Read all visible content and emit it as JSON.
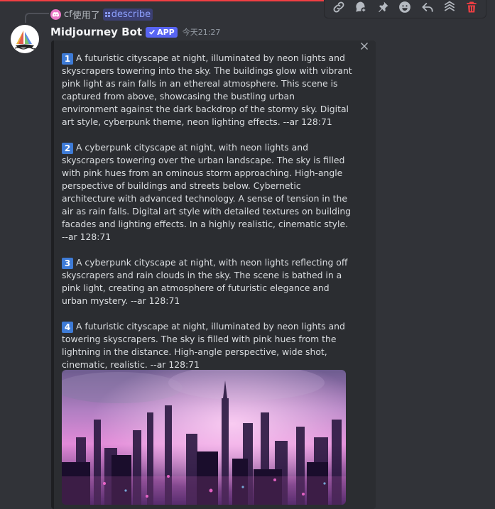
{
  "reply": {
    "user": "cf",
    "action": "使用了",
    "command": "describe"
  },
  "message": {
    "username": "Midjourney Bot",
    "badge": "APP",
    "timestamp": "今天21:27"
  },
  "embed": {
    "prompts": [
      {
        "num": "1",
        "text": "A futuristic cityscape at night, illuminated by neon lights and skyscrapers towering into the sky. The buildings glow with vibrant pink light as rain falls in an ethereal atmosphere. This scene is captured from above, showcasing the bustling urban environment against the dark backdrop of the stormy sky. Digital art style, cyberpunk theme, neon lighting effects. --ar 128:71"
      },
      {
        "num": "2",
        "text": "A cyberpunk cityscape at night, with neon lights and skyscrapers towering over the urban landscape. The sky is filled with pink hues from an ominous storm approaching. High-angle perspective of buildings and streets below. Cybernetic architecture with advanced technology. A sense of tension in the air as rain falls. Digital art style with detailed textures on building facades and lighting effects. In a highly realistic, cinematic style. --ar 128:71"
      },
      {
        "num": "3",
        "text": "A cyberpunk cityscape at night, with neon lights reflecting off skyscrapers and rain clouds in the sky. The scene is bathed in a pink light, creating an atmosphere of futuristic elegance and urban mystery. --ar 128:71"
      },
      {
        "num": "4",
        "text": "A futuristic cityscape at night, illuminated by neon lights and towering skyscrapers. The sky is filled with pink hues from the lightning in the distance. High-angle perspective, wide shot, cinematic, realistic. --ar 128:71"
      }
    ]
  },
  "toolbar_icons": [
    "link-icon",
    "thread-icon",
    "pin-icon",
    "emoji-icon",
    "reply-icon",
    "apps-icon",
    "delete-icon"
  ],
  "colors": {
    "background": "#313338",
    "embed_bg": "#2b2d31",
    "blurple": "#5865f2",
    "number_badge": "#3e7bd6",
    "danger": "#f23f43"
  }
}
